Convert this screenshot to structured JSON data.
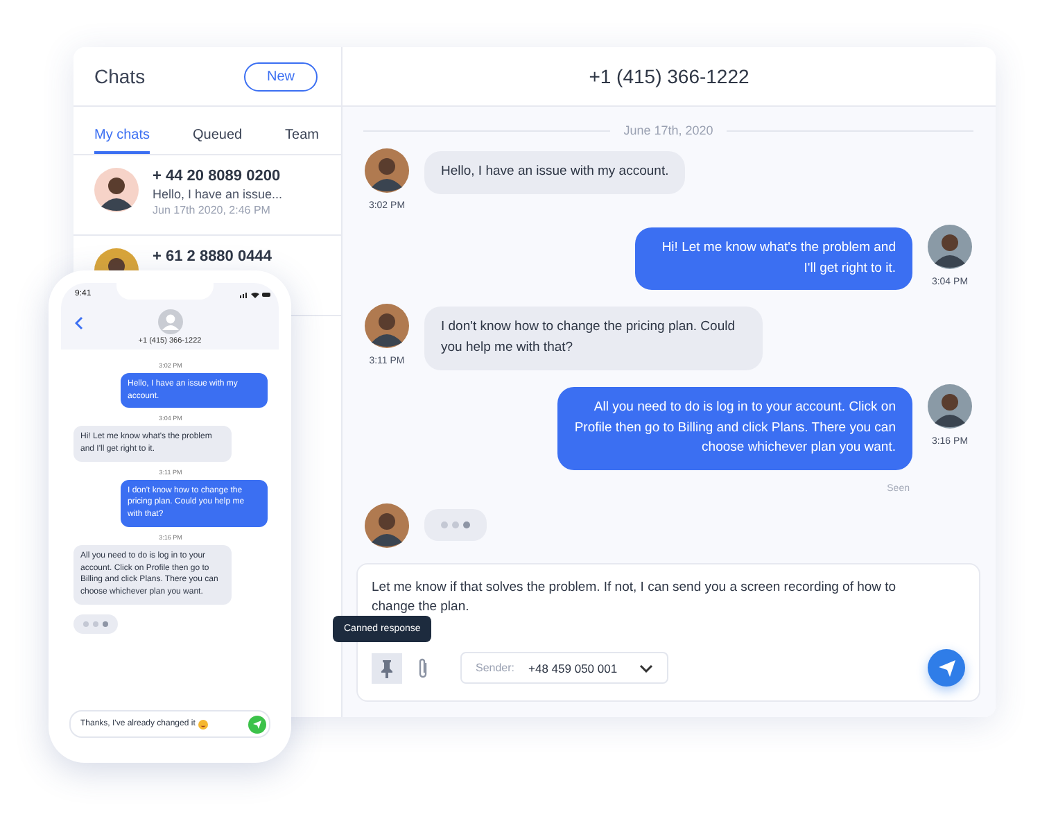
{
  "sidebar": {
    "title": "Chats",
    "new_button": "New",
    "tabs": [
      {
        "label": "My chats",
        "selected": true
      },
      {
        "label": "Queued",
        "selected": false
      },
      {
        "label": "Team",
        "selected": false
      }
    ],
    "chats": [
      {
        "name": "+ 44 20 8089 0200",
        "preview": "Hello, I have an issue...",
        "time": "Jun 17th 2020, 2:46 PM"
      },
      {
        "name": "+ 61 2 8880 0444"
      }
    ]
  },
  "conversation": {
    "title": "+1 (415) 366-1222",
    "date": "June 17th, 2020",
    "messages": [
      {
        "kind": "incoming",
        "text": "Hello, I have an issue with my account.",
        "time": "3:02 PM"
      },
      {
        "kind": "outgoing",
        "text": "Hi! Let me know what's the problem and I'll get right to it.",
        "time": "3:04 PM"
      },
      {
        "kind": "incoming",
        "text": "I don't know how to change the pricing plan. Could you help me with that?",
        "time": "3:11 PM"
      },
      {
        "kind": "outgoing",
        "text": "All you need to do is log in to your account. Click on Profile then go to Billing and click Plans. There you can choose whichever plan you want.",
        "time": "3:16 PM"
      }
    ],
    "seen": "Seen",
    "typing": true
  },
  "composer": {
    "value": "Let me know if that solves the problem. If not, I can send you a screen recording of how to change the plan.",
    "tooltip": "Canned response",
    "sender_label": "Sender:",
    "sender_value": "+48 459 050 001"
  },
  "phone": {
    "clock": "9:41",
    "contact": "+1 (415) 366-1222",
    "messages": [
      {
        "kind": "outgoing",
        "time": "3:02 PM",
        "text": "Hello, I have an issue with my account."
      },
      {
        "kind": "incoming",
        "time": "3:04 PM",
        "text": "Hi! Let me know what's the problem and I'll get right to it."
      },
      {
        "kind": "outgoing",
        "time": "3:11 PM",
        "text": "I don't know how to change the pricing plan. Could you help me with that?"
      },
      {
        "kind": "incoming",
        "time": "3:16 PM",
        "text": "All you need to do is log in to your account. Click on Profile then go to Billing and click Plans. There you can choose whichever plan you want."
      }
    ],
    "typing": true,
    "input": "Thanks, I've already changed it"
  }
}
